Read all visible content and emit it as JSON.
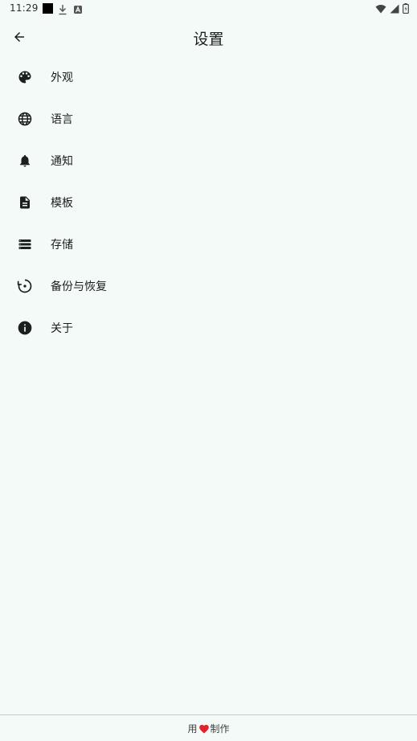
{
  "status_bar": {
    "time": "11:29"
  },
  "app_bar": {
    "title": "设置"
  },
  "settings": {
    "items": [
      {
        "label": "外观",
        "icon": "palette-icon"
      },
      {
        "label": "语言",
        "icon": "globe-icon"
      },
      {
        "label": "通知",
        "icon": "bell-icon"
      },
      {
        "label": "模板",
        "icon": "document-icon"
      },
      {
        "label": "存储",
        "icon": "storage-icon"
      },
      {
        "label": "备份与恢复",
        "icon": "restore-icon"
      },
      {
        "label": "关于",
        "icon": "info-icon"
      }
    ]
  },
  "footer": {
    "prefix": "用",
    "suffix": "制作",
    "heart_color": "#e0242e"
  },
  "colors": {
    "background": "#f4faf8",
    "icon": "#1b1f1e",
    "divider": "#c4cac8"
  }
}
